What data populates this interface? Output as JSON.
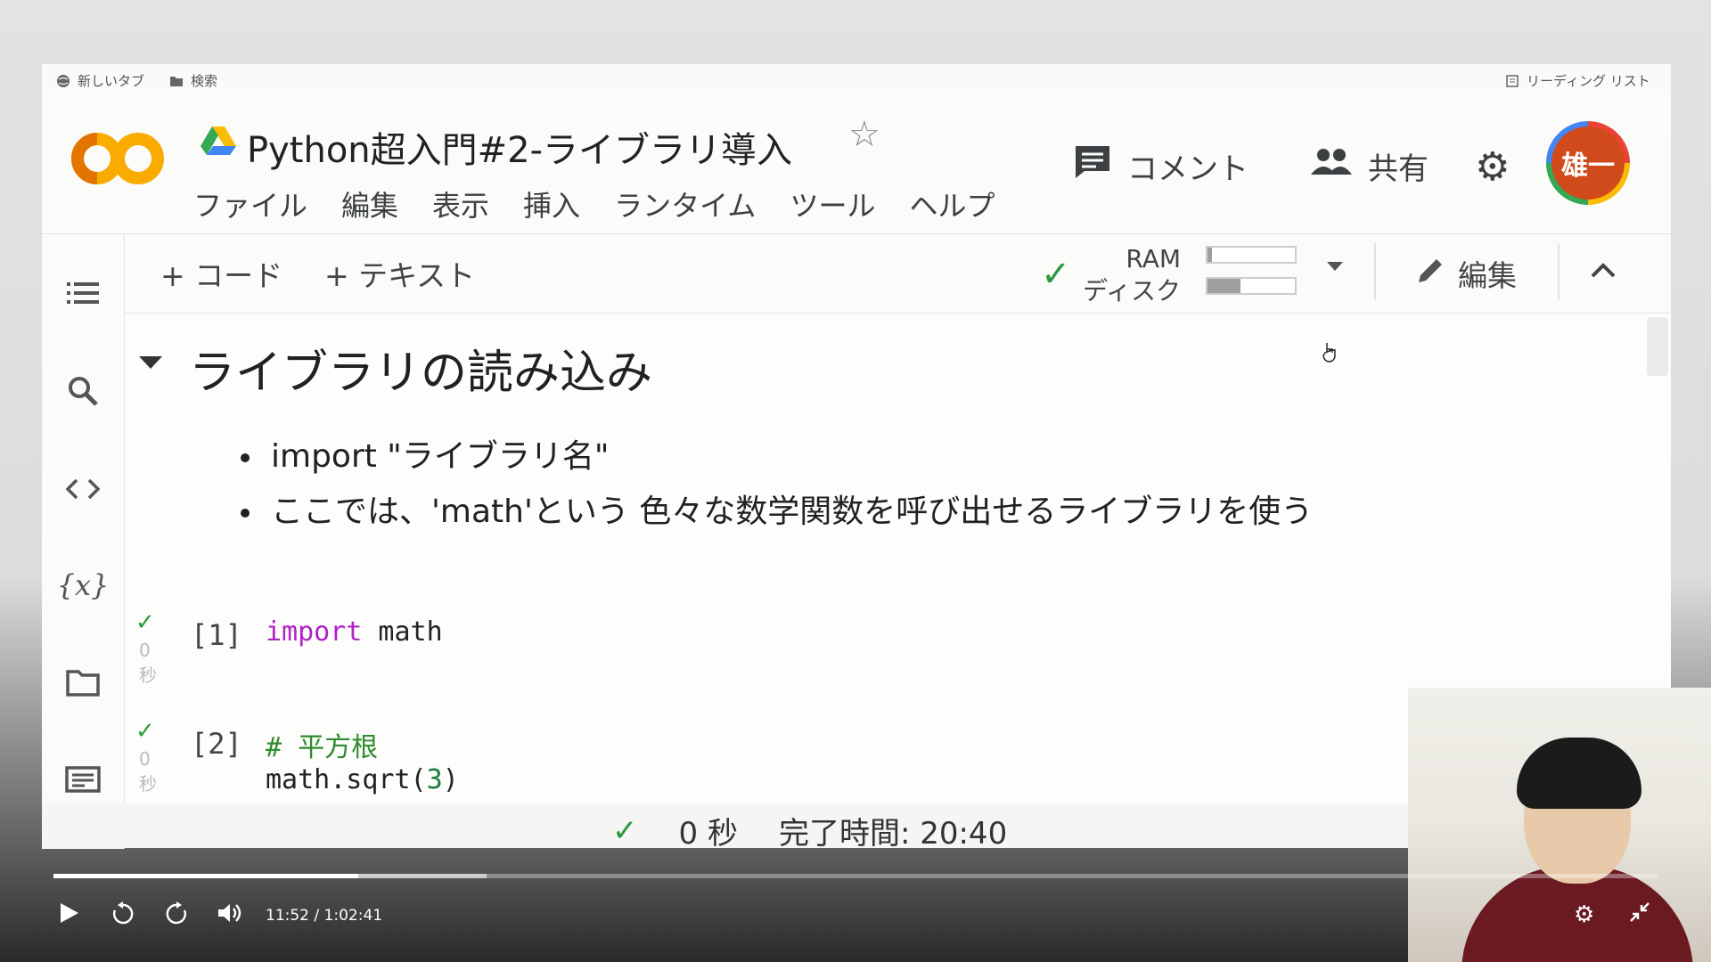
{
  "bookmarks": {
    "new_tab": "新しいタブ",
    "search": "検索",
    "reading_list": "リーディング リスト"
  },
  "header": {
    "logo_text": "CO",
    "title": "Python超入門#2-ライブラリ導入",
    "menu": [
      "ファイル",
      "編集",
      "表示",
      "挿入",
      "ランタイム",
      "ツール",
      "ヘルプ"
    ],
    "comment_label": "コメント",
    "share_label": "共有",
    "avatar_text": "雄一"
  },
  "toolbar": {
    "add_code": "+ コード",
    "add_text": "+ テキスト",
    "ram_label": "RAM",
    "disk_label": "ディスク",
    "ram_usage": 0.05,
    "disk_usage": 0.38,
    "edit_label": "編集"
  },
  "notebook": {
    "section_title": "ライブラリの読み込み",
    "bullets": [
      "import \"ライブラリ名\"",
      "ここでは、'math'という 色々な数学関数を呼び出せるライブラリを使う"
    ],
    "cells": [
      {
        "number": "[1]",
        "time": "0",
        "time_unit": "秒",
        "keyword": "import",
        "rest": " math"
      },
      {
        "number": "[2]",
        "time": "0",
        "time_unit": "秒",
        "comment": "# 平方根",
        "line2_prefix": "math.sqrt(",
        "line2_num": "3",
        "line2_suffix": ")"
      }
    ]
  },
  "status": {
    "duration": "0 秒",
    "completed": "完了時間: 20:40"
  },
  "video": {
    "current_time": "11:52",
    "separator": "/",
    "total_time": "1:02:41",
    "progress": 0.19,
    "buffered": 0.27
  },
  "colors": {
    "accent_orange": "#f9ab00",
    "check_green": "#2e9a3c",
    "keyword_purple": "#b122c8"
  }
}
